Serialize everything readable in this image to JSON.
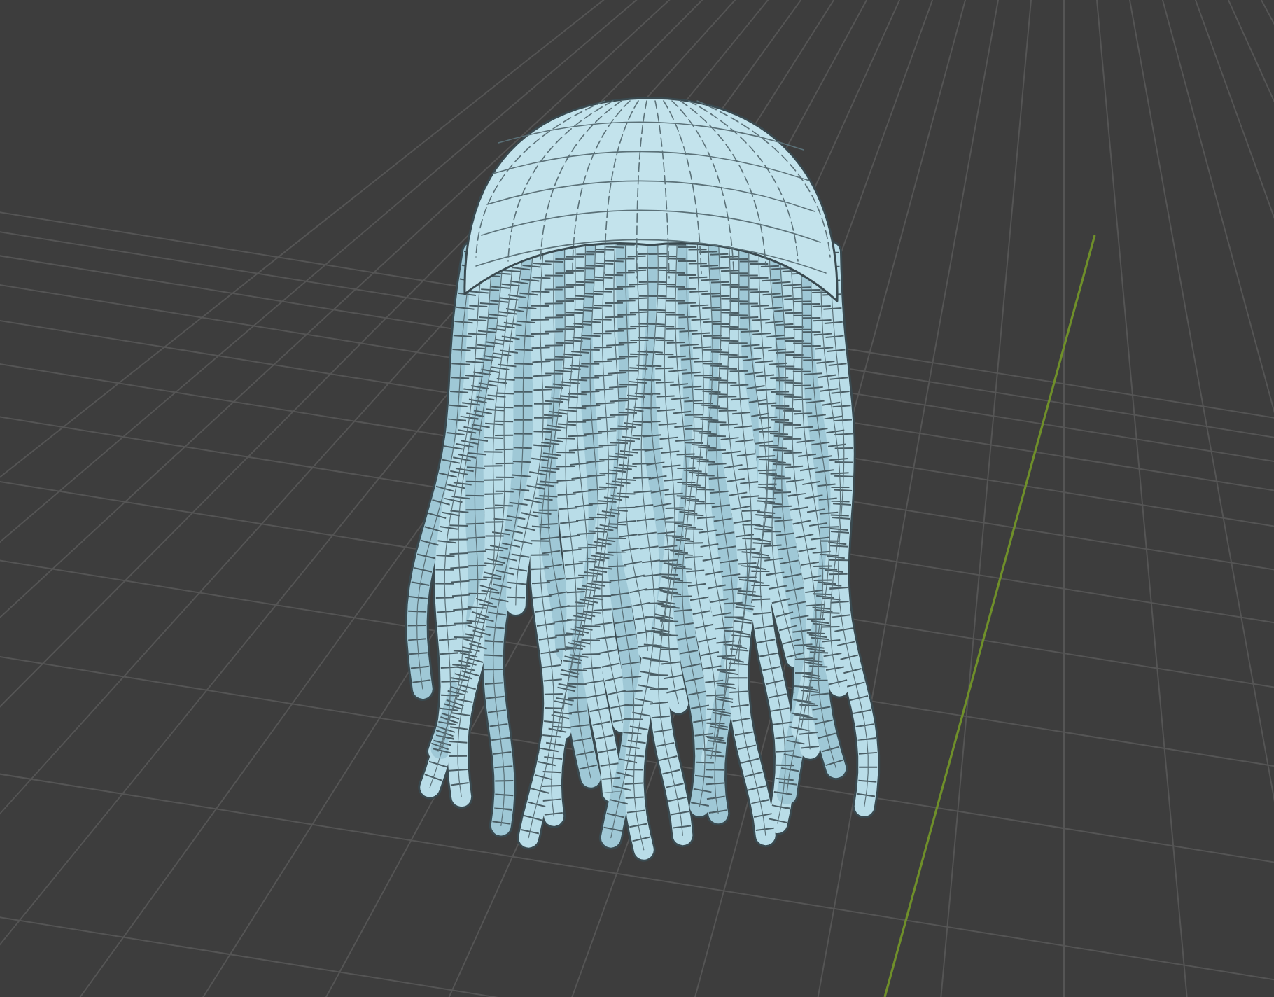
{
  "viewport": {
    "kind": "perspective",
    "grid": true,
    "axis_line": true,
    "object": {
      "kind": "hair-mesh",
      "wireframe": true
    }
  }
}
